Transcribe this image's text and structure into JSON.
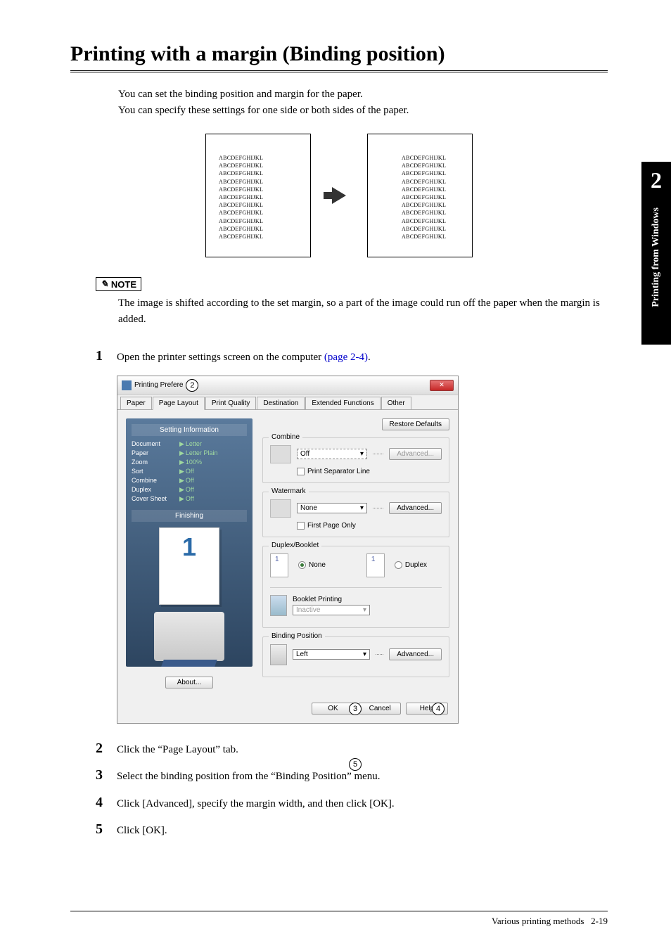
{
  "chapter": {
    "number": "2",
    "sideLabel": "Printing from Windows"
  },
  "heading": "Printing with a margin (Binding position)",
  "intro": {
    "line1": "You can set the binding position and margin for the paper.",
    "line2": "You can specify these settings for one side or both sides of the paper."
  },
  "diagram": {
    "sampleLine": "ABCDEFGHIJKL"
  },
  "note": {
    "label": "NOTE",
    "text": "The image is shifted according to the set margin, so a part of the image could run off the paper when the margin is added."
  },
  "steps": {
    "s1": {
      "n": "1",
      "text": "Open the printer settings screen on the computer ",
      "link": "(page 2-4)",
      "tail": "."
    },
    "s2": {
      "n": "2",
      "text": "Click the “Page Layout” tab."
    },
    "s3": {
      "n": "3",
      "text": "Select the binding position from the “Binding Position” menu."
    },
    "s4": {
      "n": "4",
      "text": "Click [Advanced], specify the margin width, and then click [OK]."
    },
    "s5": {
      "n": "5",
      "text": "Click [OK]."
    }
  },
  "dialog": {
    "title": "Printing Prefere",
    "closeGlyph": "✕",
    "tabs": {
      "paper": "Paper",
      "pageLayout": "Page Layout",
      "printQuality": "Print Quality",
      "destination": "Destination",
      "extended": "Extended Functions",
      "other": "Other"
    },
    "leftPanel": {
      "settingInfo": "Setting Information",
      "rows": {
        "document": {
          "label": "Document",
          "val": "Letter"
        },
        "paper": {
          "label": "Paper",
          "val": "Letter Plain"
        },
        "zoom": {
          "label": "Zoom",
          "val": "100%"
        },
        "sort": {
          "label": "Sort",
          "val": "Off"
        },
        "combine": {
          "label": "Combine",
          "val": "Off"
        },
        "duplex": {
          "label": "Duplex",
          "val": "Off"
        },
        "cover": {
          "label": "Cover Sheet",
          "val": "Off"
        }
      },
      "finishing": "Finishing",
      "previewNum": "1",
      "about": "About..."
    },
    "rightPanel": {
      "restore": "Restore Defaults",
      "combine": {
        "label": "Combine",
        "value": "Off",
        "advanced": "Advanced...",
        "sep": "Print Separator Line"
      },
      "watermark": {
        "label": "Watermark",
        "value": "None",
        "advanced": "Advanced...",
        "first": "First Page Only"
      },
      "duplexBooklet": {
        "label": "Duplex/Booklet",
        "none": "None",
        "duplex": "Duplex",
        "bookletLabel": "Booklet Printing",
        "bookletValue": "Inactive"
      },
      "binding": {
        "label": "Binding Position",
        "value": "Left",
        "advanced": "Advanced..."
      }
    },
    "footer": {
      "ok": "OK",
      "cancel": "Cancel",
      "help": "Help"
    },
    "callouts": {
      "c2": "2",
      "c3": "3",
      "c4": "4",
      "c5": "5"
    }
  },
  "footer": {
    "section": "Various printing methods",
    "page": "2-19"
  }
}
